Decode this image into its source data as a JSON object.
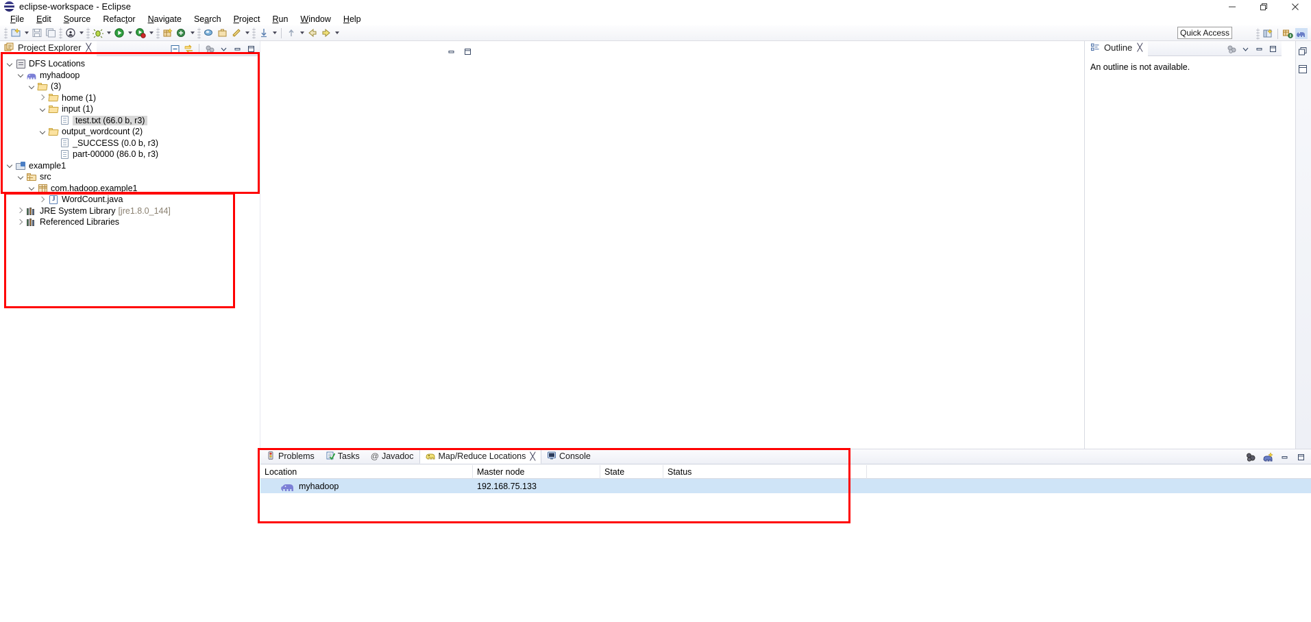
{
  "window": {
    "title": "eclipse-workspace - Eclipse",
    "icon": "eclipse-globe-icon",
    "minimize": "minimize-icon",
    "maximize": "maximize-icon",
    "close": "close-icon"
  },
  "menubar": {
    "items": [
      {
        "label": "File",
        "mnemonic": "F"
      },
      {
        "label": "Edit",
        "mnemonic": "E"
      },
      {
        "label": "Source",
        "mnemonic": "S"
      },
      {
        "label": "Refactor",
        "mnemonic": "t"
      },
      {
        "label": "Navigate",
        "mnemonic": "N"
      },
      {
        "label": "Search",
        "mnemonic": "a"
      },
      {
        "label": "Project",
        "mnemonic": "P"
      },
      {
        "label": "Run",
        "mnemonic": "R"
      },
      {
        "label": "Window",
        "mnemonic": "W"
      },
      {
        "label": "Help",
        "mnemonic": "H"
      }
    ]
  },
  "toolbar": {
    "quick_access_placeholder": "Quick Access",
    "items": [
      "new-wizard-icon",
      "save-icon",
      "save-all-icon",
      "print-icon",
      "debug-icon",
      "run-icon",
      "run-coverage-icon",
      "external-tools-icon",
      "new-java-package-icon",
      "new-java-class-icon",
      "search-icon",
      "open-task-icon",
      "skip-breakpoints-icon",
      "next-annotation-icon",
      "previous-annotation-icon",
      "back-icon",
      "forward-icon"
    ],
    "right_items": [
      "open-perspective-icon",
      "java-perspective-icon",
      "mapreduce-perspective-icon"
    ]
  },
  "project_explorer": {
    "tab_label": "Project Explorer",
    "tab_icon": "project-explorer-icon",
    "tab_close": "╳",
    "tools": [
      "collapse-all-icon",
      "link-with-editor-icon",
      "focus-on-active-task-icon",
      "view-menu-icon",
      "minimize-icon",
      "maximize-icon"
    ],
    "tree": [
      {
        "indent": 0,
        "twisty": "down",
        "icon": "dfs-locations-icon",
        "label": "DFS Locations",
        "selected": false
      },
      {
        "indent": 1,
        "twisty": "down",
        "icon": "hadoop-elephant-icon",
        "label": "myhadoop",
        "selected": false
      },
      {
        "indent": 2,
        "twisty": "down",
        "icon": "folder-open-icon",
        "label": "(3)",
        "selected": false
      },
      {
        "indent": 3,
        "twisty": "right",
        "icon": "folder-open-icon",
        "label": "home (1)",
        "selected": false
      },
      {
        "indent": 3,
        "twisty": "down",
        "icon": "folder-open-icon",
        "label": "input (1)",
        "selected": false
      },
      {
        "indent": 4,
        "twisty": "none",
        "icon": "file-icon",
        "label": "test.txt (66.0 b, r3)",
        "selected": true
      },
      {
        "indent": 3,
        "twisty": "down",
        "icon": "folder-open-icon",
        "label": "output_wordcount (2)",
        "selected": false
      },
      {
        "indent": 4,
        "twisty": "none",
        "icon": "file-icon",
        "label": "_SUCCESS (0.0 b, r3)",
        "selected": false
      },
      {
        "indent": 4,
        "twisty": "none",
        "icon": "file-icon",
        "label": "part-00000 (86.0 b, r3)",
        "selected": false
      },
      {
        "indent": 0,
        "twisty": "down",
        "icon": "java-project-icon",
        "label": "example1",
        "selected": false
      },
      {
        "indent": 1,
        "twisty": "down",
        "icon": "source-folder-icon",
        "label": "src",
        "selected": false
      },
      {
        "indent": 2,
        "twisty": "down",
        "icon": "package-icon",
        "label": "com.hadoop.example1",
        "selected": false
      },
      {
        "indent": 3,
        "twisty": "right",
        "icon": "java-file-icon",
        "label": "WordCount.java",
        "selected": false
      },
      {
        "indent": 1,
        "twisty": "right",
        "icon": "library-icon",
        "label": "JRE System Library ",
        "suffix": "[jre1.8.0_144]",
        "selected": false
      },
      {
        "indent": 1,
        "twisty": "right",
        "icon": "library-icon",
        "label": "Referenced Libraries",
        "selected": false
      }
    ]
  },
  "outline": {
    "tab_label": "Outline",
    "tab_icon": "outline-icon",
    "tab_close": "╳",
    "tools": [
      "view-menu-icon",
      "minimize-icon",
      "maximize-icon"
    ],
    "message": "An outline is not available."
  },
  "editor": {
    "tools": [
      "minimize-icon",
      "maximize-icon"
    ]
  },
  "right_strip": {
    "items": [
      "restore-icon",
      "outline-view-icon"
    ]
  },
  "bottom_panel": {
    "tabs": [
      {
        "label": "Problems",
        "icon": "problems-icon",
        "active": false
      },
      {
        "label": "Tasks",
        "icon": "tasks-icon",
        "active": false
      },
      {
        "label": "Javadoc",
        "icon": "javadoc-icon",
        "active": false
      },
      {
        "label": "Map/Reduce Locations",
        "icon": "mapreduce-icon",
        "active": true,
        "close": "╳"
      },
      {
        "label": "Console",
        "icon": "console-icon",
        "active": false
      }
    ],
    "tools": [
      "new-hadoop-location-icon",
      "edit-hadoop-location-icon",
      "minimize-icon",
      "maximize-icon"
    ],
    "table": {
      "columns": [
        "Location",
        "Master node",
        "State",
        "Status"
      ],
      "rows": [
        {
          "location": "myhadoop",
          "location_icon": "hadoop-elephant-icon",
          "master_node": "192.168.75.133",
          "state": "",
          "status": ""
        }
      ]
    }
  },
  "annotations": {
    "color": "#ff0000",
    "boxes": [
      {
        "name": "dfs-locations-highlight"
      },
      {
        "name": "java-project-highlight"
      },
      {
        "name": "mapreduce-locations-highlight"
      }
    ]
  }
}
